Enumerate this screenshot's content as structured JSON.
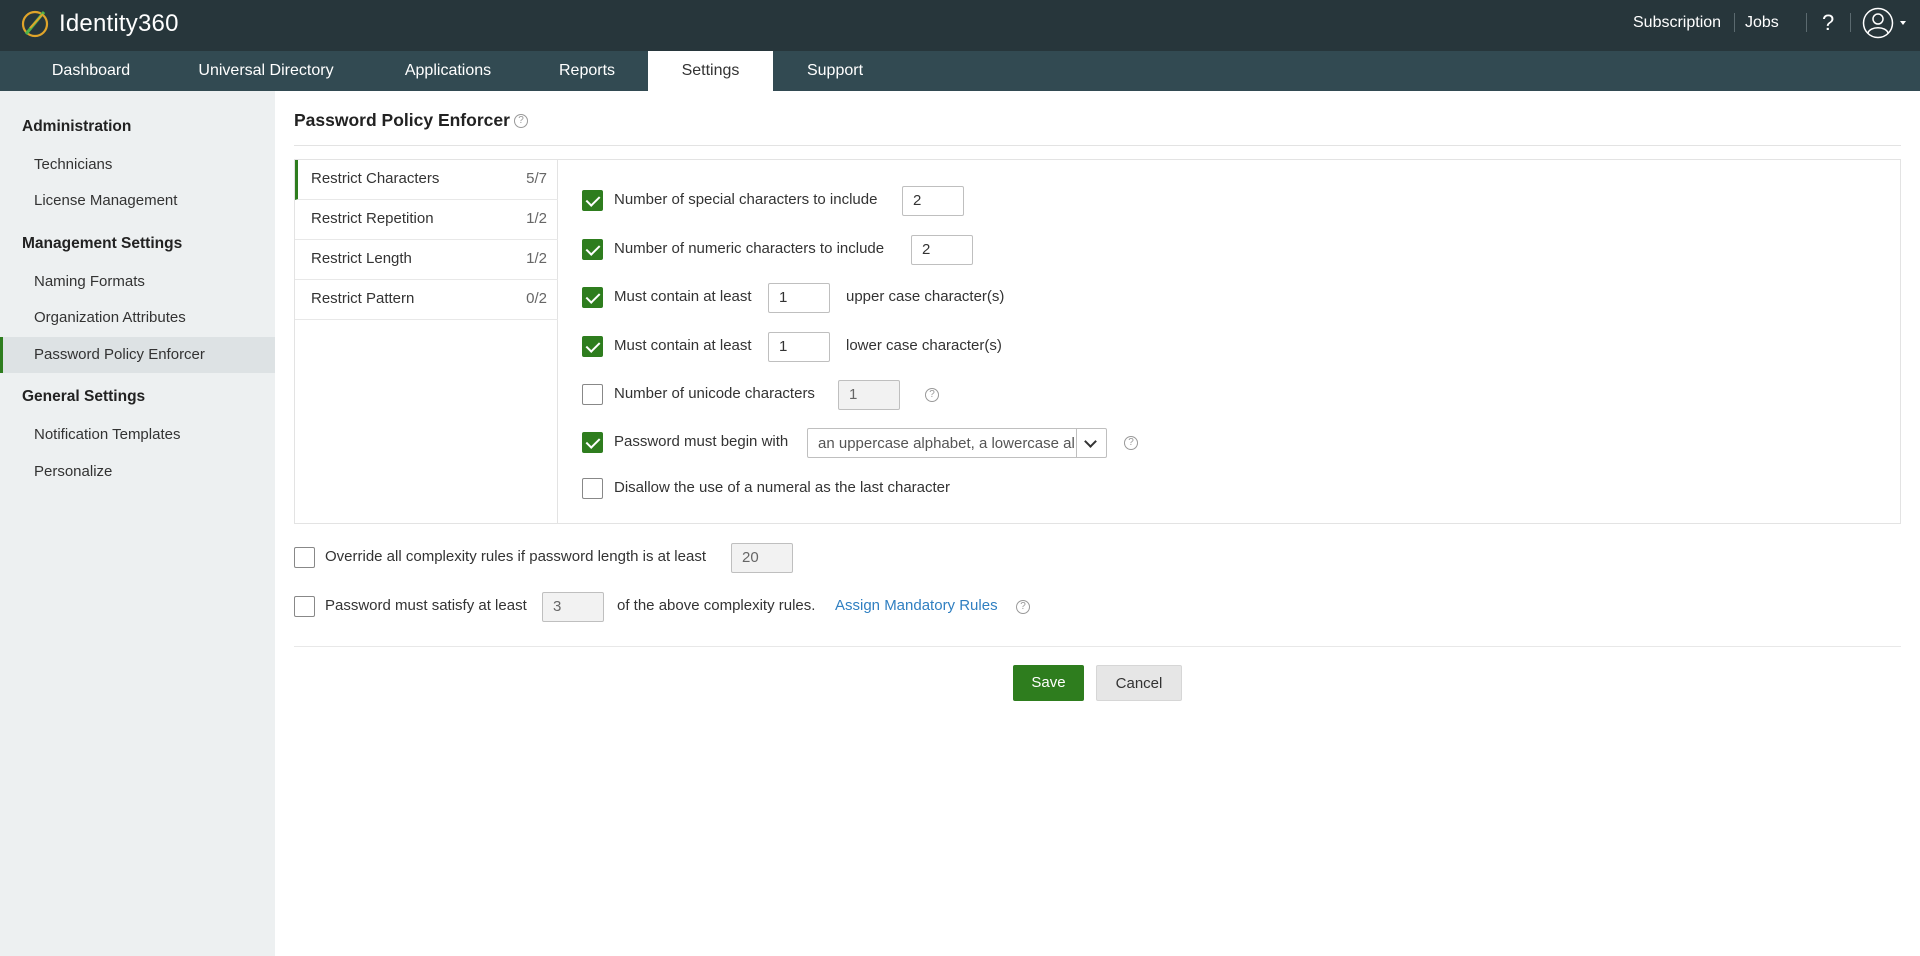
{
  "app": {
    "brand": "Identity360",
    "top_links": [
      "Subscription",
      "Jobs"
    ],
    "help_label": "?"
  },
  "nav": {
    "tabs": [
      "Dashboard",
      "Universal Directory",
      "Applications",
      "Reports",
      "Settings",
      "Support"
    ],
    "active": "Settings"
  },
  "sidebar": {
    "sections": [
      {
        "title": "Administration",
        "items": [
          "Technicians",
          "License Management"
        ]
      },
      {
        "title": "Management Settings",
        "items": [
          "Naming Formats",
          "Organization Attributes",
          "Password Policy Enforcer"
        ]
      },
      {
        "title": "General Settings",
        "items": [
          "Notification Templates",
          "Personalize"
        ]
      }
    ],
    "active_item": "Password Policy Enforcer"
  },
  "page": {
    "title": "Password Policy Enforcer"
  },
  "policy_tabs": [
    {
      "label": "Restrict Characters",
      "count": "5/7"
    },
    {
      "label": "Restrict Repetition",
      "count": "1/2"
    },
    {
      "label": "Restrict Length",
      "count": "1/2"
    },
    {
      "label": "Restrict Pattern",
      "count": "0/2"
    }
  ],
  "rules": {
    "special": {
      "label": "Number of special characters to include",
      "value": "2",
      "checked": true
    },
    "numeric": {
      "label": "Number of numeric characters to include",
      "value": "2",
      "checked": true
    },
    "upper": {
      "label": "Must contain at least",
      "value": "1",
      "suffix": "upper case character(s)",
      "checked": true
    },
    "lower": {
      "label": "Must contain at least",
      "value": "1",
      "suffix": "lower case character(s)",
      "checked": true
    },
    "unicode": {
      "label": "Number of unicode characters",
      "value": "1",
      "checked": false
    },
    "begin": {
      "label": "Password must begin with",
      "value": "an uppercase alphabet, a lowercase alphabet",
      "checked": true
    },
    "last_numeral": {
      "label": "Disallow the use of a numeral as the last character",
      "checked": false
    }
  },
  "override": {
    "label": "Override all complexity rules if password length is at least",
    "value": "20",
    "checked": false
  },
  "satisfy": {
    "label": "Password must satisfy at least",
    "value": "3",
    "suffix": "of the above complexity rules.",
    "link": "Assign Mandatory Rules",
    "checked": false
  },
  "buttons": {
    "save": "Save",
    "cancel": "Cancel"
  },
  "colors": {
    "topbar": "#27363b",
    "navbar": "#324a52",
    "accent": "#2e7d1e",
    "link": "#2f7fc1"
  }
}
